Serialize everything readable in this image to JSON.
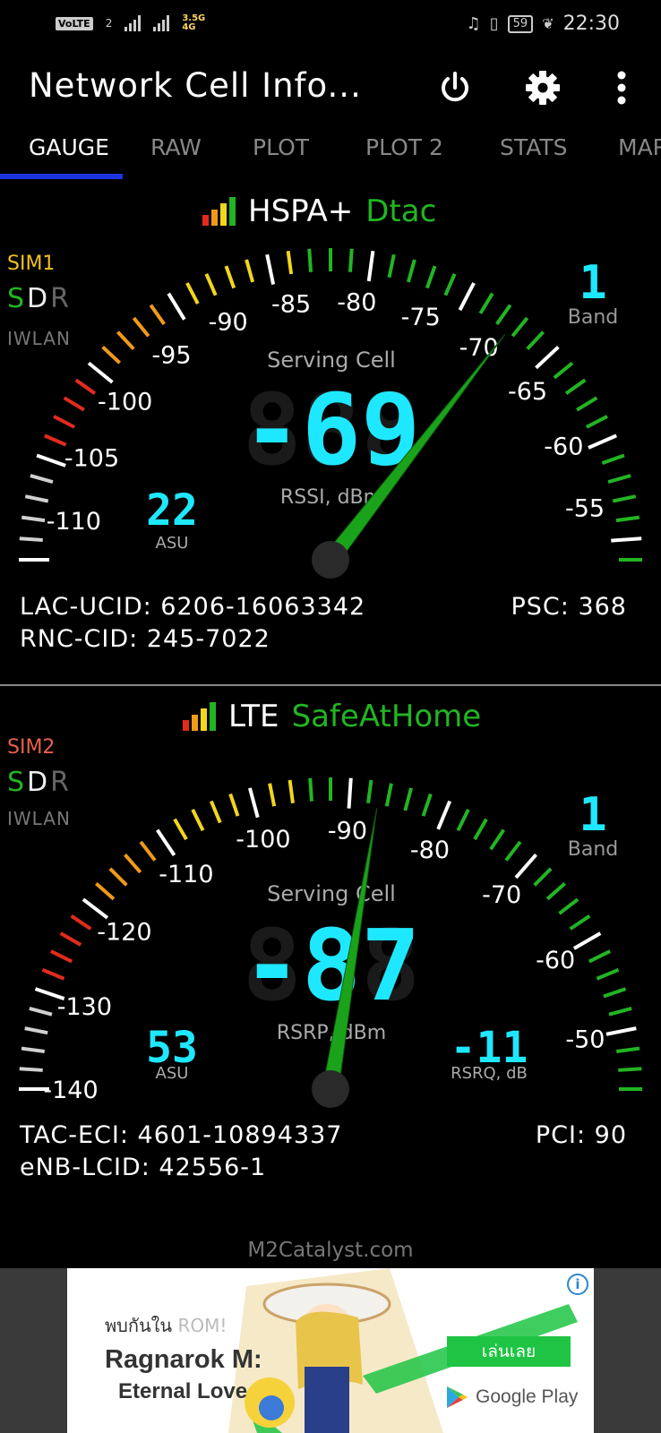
{
  "status_bar": {
    "volte_label": "VoLTE",
    "sim_slot": "2",
    "net_type": "3.5G\n4G",
    "battery": "59",
    "time": "22:30"
  },
  "app": {
    "title": "Network Cell Info...",
    "power_icon": "power-icon",
    "settings_icon": "gear-icon",
    "menu_icon": "more-vert-icon"
  },
  "tabs": [
    "GAUGE",
    "RAW",
    "PLOT",
    "PLOT 2",
    "STATS",
    "MAP"
  ],
  "sim1": {
    "tech": "HSPA+",
    "operator": "Dtac",
    "sim_label": "SIM1",
    "sdr": [
      "S",
      "D",
      "R"
    ],
    "iwlan": "IWLAN",
    "band_value": "1",
    "band_label": "Band",
    "gauge": {
      "min": -113,
      "max": -51,
      "value": -69,
      "tick_labels": [
        "-110",
        "-105",
        "-100",
        "-95",
        "-90",
        "-85",
        "-80",
        "-75",
        "-70",
        "-65",
        "-60",
        "-55"
      ],
      "caption": "Serving Cell",
      "main_value": "-69",
      "unit": "RSSI, dBm",
      "asu_value": "22",
      "asu_label": "ASU"
    },
    "lac_ucid": "LAC-UCID: 6206-16063342",
    "rnc_cid": "RNC-CID: 245-7022",
    "psc": "PSC: 368",
    "colors": {
      "tech_bar_1": "#e32b1d",
      "tech_bar_2": "#f09a19",
      "tech_bar_3": "#f2d51e",
      "tech_bar_4": "#22b522"
    }
  },
  "sim2": {
    "tech": "LTE",
    "operator": "SafeAtHome",
    "sim_label": "SIM2",
    "sdr": [
      "S",
      "D",
      "R"
    ],
    "iwlan": "IWLAN",
    "band_value": "1",
    "band_label": "Band",
    "gauge": {
      "min": -140,
      "max": -44,
      "value": -87,
      "tick_labels": [
        "-140",
        "-130",
        "-120",
        "-110",
        "-100",
        "-90",
        "-80",
        "-70",
        "-60",
        "-50"
      ],
      "caption": "Serving Cell",
      "main_value": "-87",
      "unit": "RSRP, dBm",
      "asu_value": "53",
      "asu_label": "ASU",
      "rsrq_value": "-11",
      "rsrq_label": "RSRQ, dB"
    },
    "tac_eci": "TAC-ECI: 4601-10894337",
    "enb_lcid": "eNB-LCID: 42556-1",
    "pci": "PCI: 90"
  },
  "footer_link": "M2Catalyst.com",
  "ad": {
    "info_icon": "info-icon",
    "promo_prefix": "พบกันใน",
    "promo_suffix": "ROM!",
    "title_line1": "Ragnarok M:",
    "title_line2": "Eternal Love",
    "cta": "เล่นเลย",
    "store": "Google Play"
  },
  "theme": {
    "accent_blue": "#1a35e0",
    "digit_cyan": "#1ee8ff",
    "needle_green": "#1aa31a",
    "operator_green": "#22b522"
  }
}
